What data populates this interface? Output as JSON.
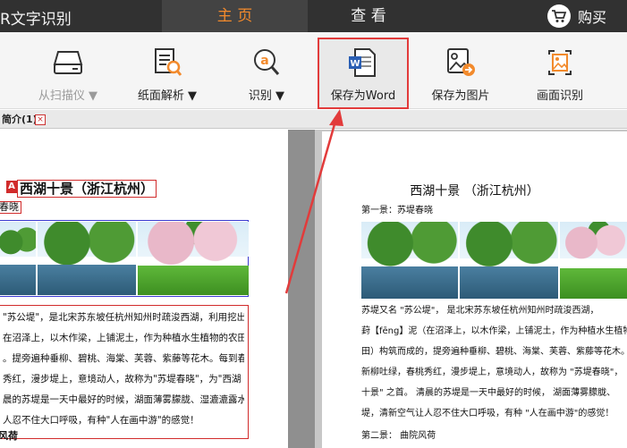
{
  "titlebar": {
    "app_title": "R文字识别",
    "tabs": [
      {
        "label": "主 页",
        "active": true
      },
      {
        "label": "查 看",
        "active": false
      }
    ],
    "buy_label": "购买"
  },
  "toolbar": {
    "items": [
      {
        "label": "从扫描仪 ▼",
        "icon": "scanner-icon",
        "enabled": false
      },
      {
        "label": "纸面解析 ▼",
        "icon": "document-analyze-icon",
        "enabled": true
      },
      {
        "label": "识别 ▼",
        "icon": "ocr-recognize-icon",
        "enabled": true
      },
      {
        "label": "保存为Word",
        "icon": "word-save-icon",
        "enabled": true
      },
      {
        "label": "保存为图片",
        "icon": "image-save-icon",
        "enabled": true
      },
      {
        "label": "画面识别",
        "icon": "screen-capture-icon",
        "enabled": true
      }
    ]
  },
  "doc_tab": {
    "label": "简介(1)",
    "close": "×"
  },
  "left_pane": {
    "badge": "A",
    "title": "西湖十景（浙江杭州）",
    "subtitle": "春晓",
    "paragraph_lines": [
      "\"苏公堤\"，是北宋苏东坡任杭州知州时疏浚西湖，利用挖出的",
      "在沼泽上，以木作梁，上铺泥土，作为种植水生植物的农田，叫葑",
      "。提旁遍种垂柳、碧桃、海棠、芙蓉、紫藤等花木。每到春季，",
      "秀红，漫步堤上，意境动人，故称为\"苏堤春晓\"，为\"西湖",
      "晨的苏堤是一天中最好的时候，湖面薄雾朦胧、湿漉漉露水满",
      "人忍不住大口呼吸，有种\"人在画中游\"的感觉！"
    ],
    "next_heading": "风荷"
  },
  "right_pane": {
    "title": "西湖十景 （浙江杭州）",
    "subtitle": "第一景：苏堤春晓",
    "paragraph_lines": [
      "苏堤又名 \"苏公堤\"， 是北宋苏东坡任杭州知州时疏浚西湖，",
      "葑【fēng】泥（在沼泽上，以木作梁，上铺泥土，作为种植水生植物的",
      "田）构筑而成的，提旁遍种垂柳、碧桃、海棠、芙蓉、紫藤等花木。",
      "新柳吐绿，春桃秀红，漫步堤上，意境动人，故称为 \"苏堤春晓\"，",
      "十景\" 之首。 清晨的苏堤是一天中最好的时候， 湖面薄雾朦胧、",
      "堤，清新空气让人忍不住大口呼吸，有种 \"人在画中游\"的感觉！"
    ],
    "next_heading": "第二景：   曲院风荷"
  },
  "colors": {
    "titlebar_bg": "#313131",
    "active_tab_text": "#f28a2c",
    "highlight_red": "#e23b3b",
    "block_blue": "#3b3bd0"
  }
}
